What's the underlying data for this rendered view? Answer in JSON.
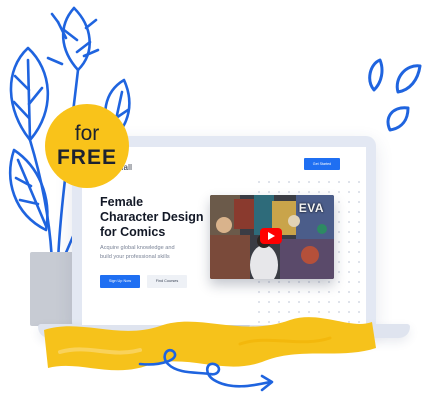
{
  "badge": {
    "line1": "for",
    "line2": "FREE"
  },
  "header": {
    "brand": "uMall",
    "get_started_label": "Get Started"
  },
  "hero": {
    "title_lines": [
      "Female",
      "Character Design",
      "for Comics"
    ],
    "subtitle_lines": [
      "Acquire global knowledge and",
      "build your professional skills"
    ],
    "signup_label": "Sign Up Now",
    "find_courses_label": "Find Courses"
  },
  "video": {
    "overlay_text": "EVA",
    "icon": "play-icon"
  },
  "colors": {
    "accent_blue": "#1f6ff2",
    "badge_yellow": "#f9c31a",
    "brush_yellow": "#f6c21b",
    "play_red": "#ff0000"
  }
}
